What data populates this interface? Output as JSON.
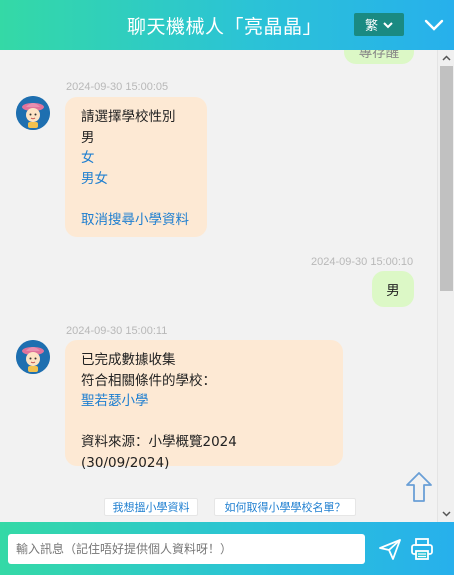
{
  "header": {
    "title": "聊天機械人「亮晶晶」",
    "lang_label": "繁"
  },
  "messages": {
    "partial_user_text": "專存醒",
    "m1": {
      "time": "2024-09-30 15:00:05",
      "line1": "請選擇學校性別",
      "line2": "男",
      "opt1": "女",
      "opt2": "男女",
      "cancel": "取消搜尋小學資料"
    },
    "m2": {
      "time": "2024-09-30 15:00:10",
      "text": "男"
    },
    "m3": {
      "time": "2024-09-30 15:00:11",
      "line1": "已完成數據收集",
      "line2": "符合相關條件的學校：",
      "school": "聖若瑟小學",
      "source": "資料來源：小學概覽2024 (30/09/2024)"
    }
  },
  "quick_replies": [
    "我想搵小學資料",
    "如何取得小學學校名單？"
  ],
  "input": {
    "placeholder": "輸入訊息（記住唔好提供個人資料呀！）",
    "value": ""
  },
  "colors": {
    "header_start": "#34d9a6",
    "header_end": "#27b0ec",
    "bot_bubble": "#fde9d4",
    "user_bubble": "#dcf8c6",
    "link": "#1f7fd0",
    "lang_button": "#1a8a82"
  },
  "icons": {
    "collapse": "chevron-down-icon",
    "send": "paper-plane-icon",
    "print": "printer-icon",
    "scroll_top": "arrow-up-icon"
  }
}
